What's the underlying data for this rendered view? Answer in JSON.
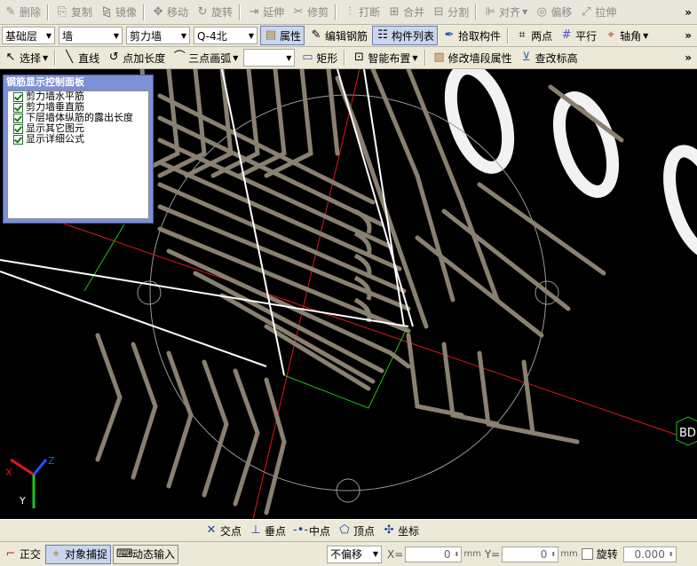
{
  "toolbar1": {
    "delete": "删除",
    "copy": "复制",
    "mirror": "镜像",
    "move": "移动",
    "rotate": "旋转",
    "extend": "延伸",
    "trim": "修剪",
    "break": "打断",
    "merge": "合并",
    "split": "分割",
    "align": "对齐",
    "offset": "偏移",
    "stretch": "拉伸"
  },
  "toolbar2": {
    "floor": "基础层",
    "category": "墙",
    "type": "剪力墙",
    "element": "Q-4北",
    "properties": "属性",
    "edit_rebar": "编辑钢筋",
    "element_list": "构件列表",
    "pick_element": "拾取构件",
    "two_points": "两点",
    "parallel": "平行",
    "axis_angle": "轴角"
  },
  "toolbar3": {
    "select": "选择",
    "line": "直线",
    "point_length": "点加长度",
    "three_point_arc": "三点画弧",
    "arc_combo": "",
    "rectangle": "矩形",
    "smart_layout": "智能布置",
    "modify_wall_props": "修改墙段属性",
    "modify_elevation": "查改标高"
  },
  "panel": {
    "title": "钢筋显示控制面板",
    "items": [
      "剪力墙水平筋",
      "剪力墙垂直筋",
      "下层墙体纵筋的露出长度",
      "显示其它图元",
      "显示详细公式"
    ]
  },
  "canvas": {
    "axis_label": "BD",
    "axis_x": "X",
    "axis_y": "Y",
    "axis_z": "Z"
  },
  "snap": {
    "intersection": "交点",
    "perpendicular": "垂点",
    "midpoint": "中点",
    "vertex": "顶点",
    "coordinate": "坐标"
  },
  "status": {
    "ortho": "正交",
    "object_snap": "对象捕捉",
    "dynamic_input": "动态输入",
    "no_offset": "不偏移",
    "x_label": "X=",
    "x_value": "0",
    "y_label": "Y=",
    "y_value": "0",
    "unit": "mm",
    "rotate_label": "旋转",
    "rotate_value": "0.000"
  },
  "colors": {
    "canvas": "#000000",
    "rebar": "#8a8070",
    "axis_red": "#e01818",
    "outline_green": "#21c021",
    "panel_title": "#7d8fd6"
  }
}
